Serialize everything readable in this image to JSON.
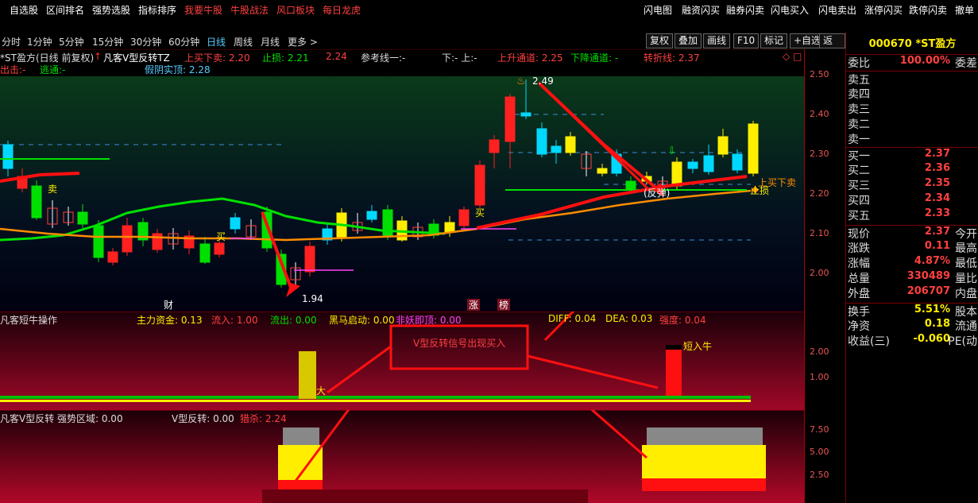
{
  "menu": [
    "自选股",
    "区间排名",
    "强势选股",
    "指标排序",
    "我要牛股",
    "牛股战法",
    "风口板块",
    "每日龙虎"
  ],
  "menu_right": [
    "闪电图",
    "融资闪买",
    "融券闪卖",
    "闪电买入",
    "闪电卖出",
    "涨停闪买",
    "跌停闪卖",
    "撤单"
  ],
  "period": [
    "分时",
    "1分钟",
    "5分钟",
    "15分钟",
    "30分钟",
    "60分钟",
    "日线",
    "周线",
    "月线",
    "更多 >"
  ],
  "period_selected": "日线",
  "toolbar": [
    "复权",
    "叠加",
    "画线",
    "F10",
    "标记",
    "+自选",
    "返回"
  ],
  "header1": {
    "title": "*ST盈方(日线 前复权)",
    "indicator": "凡客V型反转TZ",
    "shangmai": "上买下卖: 2.20",
    "zhisun": "止损: 2.21",
    "val3": "2.24",
    "ref": "参考线一:-",
    "xia": "下:- 上:-",
    "up_channel": "上升通道: 2.25",
    "down_channel": "下降通道: -",
    "turn": "转折线: 2.37"
  },
  "header2": {
    "chuji": "出击:-",
    "taotong": "逃通:-",
    "jiayin": "假阴实顶: 2.28"
  },
  "chart_labels": {
    "peak": "2.49",
    "low": "1.94",
    "buy_sell": "上买下卖",
    "stoploss": "止损",
    "rebound": "(反弹)",
    "sell1": "卖",
    "buy1": "买",
    "buy2": "买",
    "cai": "财",
    "zhang": "涨",
    "bang": "榜",
    "xiao": "小",
    "da": "大"
  },
  "sub1": {
    "name": "凡客短牛操作",
    "zhuli": "主力资金: 0.13",
    "liuru": "流入: 1.00",
    "liuchu": "流出: 0.00",
    "heima": "黑马启动: 0.00",
    "feiyao": "非妖即顶: 0.00",
    "diff": "DIFF: 0.04",
    "dea": "DEA: 0.03",
    "qiangdu": "强度: 0.04",
    "short_bull": "短入牛",
    "callout": "V型反转信号出现买入"
  },
  "sub2": {
    "name": "凡客V型反转",
    "zone": "强势区域: 0.00",
    "vtype": "V型反转: 0.00",
    "lie": "猎杀: 2.24"
  },
  "axis_main": [
    "2.50",
    "2.40",
    "2.30",
    "2.20",
    "2.10",
    "2.00"
  ],
  "axis_sub1": [
    "2.00",
    "1.00"
  ],
  "axis_sub2": [
    "7.50",
    "5.00",
    "2.50"
  ],
  "quote": {
    "code": "000670 *ST盈方",
    "weibi_l": "委比",
    "weibi_v": "100.00%",
    "weibi_r": "委差",
    "sell": [
      {
        "l": "卖五",
        "v": ""
      },
      {
        "l": "卖四",
        "v": ""
      },
      {
        "l": "卖三",
        "v": ""
      },
      {
        "l": "卖二",
        "v": ""
      },
      {
        "l": "卖一",
        "v": ""
      }
    ],
    "buy": [
      {
        "l": "买一",
        "v": "2.37"
      },
      {
        "l": "买二",
        "v": "2.36"
      },
      {
        "l": "买三",
        "v": "2.35"
      },
      {
        "l": "买四",
        "v": "2.34"
      },
      {
        "l": "买五",
        "v": "2.33"
      }
    ],
    "stats": [
      {
        "l": "现价",
        "v": "2.37",
        "r": "今开"
      },
      {
        "l": "涨跌",
        "v": "0.11",
        "r": "最高"
      },
      {
        "l": "涨幅",
        "v": "4.87%",
        "r": "最低"
      },
      {
        "l": "总量",
        "v": "330489",
        "r": "量比"
      },
      {
        "l": "外盘",
        "v": "206707",
        "r": "内盘"
      },
      {
        "l": "换手",
        "v": "5.51%",
        "r": "股本"
      },
      {
        "l": "净资",
        "v": "0.18",
        "r": "流通"
      },
      {
        "l": "收益(三)",
        "v": "-0.060",
        "r": "PE(动"
      }
    ]
  },
  "colors": {
    "up": "#ff2020",
    "down": "#00d8ff",
    "yellow": "#ffee00",
    "green": "#00e000",
    "orange": "#ff8c00",
    "magenta": "#ff40ff"
  }
}
